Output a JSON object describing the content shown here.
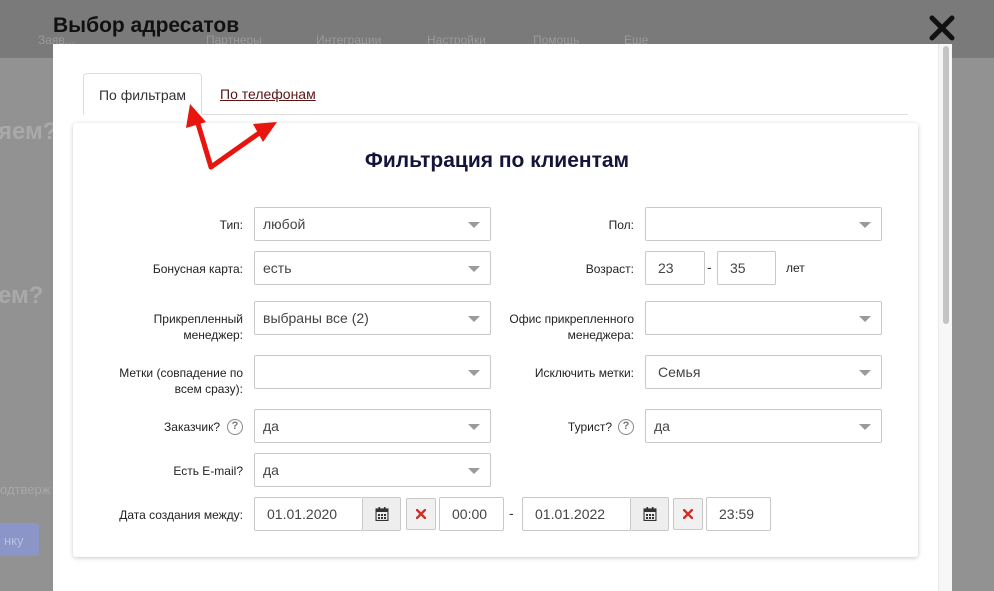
{
  "background": {
    "nav_items": [
      "Заяв...",
      "Партнеры",
      "Интеграции",
      "Настройки",
      "Помощь",
      "Еще"
    ],
    "side_texts": [
      "яем?",
      "ем?"
    ],
    "bottom_left_text": "одтверж",
    "button_text": "нку"
  },
  "modal": {
    "title": "Выбор адресатов"
  },
  "tabs": [
    {
      "label": "По фильтрам",
      "active": true
    },
    {
      "label": "По телефонам",
      "active": false
    }
  ],
  "panel": {
    "title": "Фильтрация по клиентам",
    "fields": {
      "type": {
        "label": "Тип:",
        "value": "любой"
      },
      "gender": {
        "label": "Пол:",
        "value": ""
      },
      "bonus_card": {
        "label": "Бонусная карта:",
        "value": "есть"
      },
      "age": {
        "label": "Возраст:",
        "from": "23",
        "to": "35",
        "unit": "лет",
        "separator": "-"
      },
      "manager": {
        "label_line1": "Прикрепленный",
        "label_line2": "менеджер:",
        "value": "выбраны все (2)"
      },
      "manager_office": {
        "label_line1": "Офис прикрепленного",
        "label_line2": "менеджера:",
        "value": ""
      },
      "tags": {
        "label_line1": "Метки (совпадение по",
        "label_line2": "всем сразу):",
        "value": ""
      },
      "exclude_tags": {
        "label": "Исключить метки:",
        "value": "Семья"
      },
      "customer": {
        "label": "Заказчик?",
        "value": "да"
      },
      "tourist": {
        "label": "Турист?",
        "value": "да"
      },
      "email": {
        "label": "Есть E-mail?",
        "value": "да"
      },
      "created": {
        "label": "Дата создания между:",
        "date_from": "01.01.2020",
        "time_from": "00:00",
        "separator": "-",
        "date_to": "01.01.2022",
        "time_to": "23:59"
      }
    }
  },
  "colors": {
    "annotation_arrow": "#e8150f",
    "link": "#5a1414",
    "title": "#14143a"
  }
}
